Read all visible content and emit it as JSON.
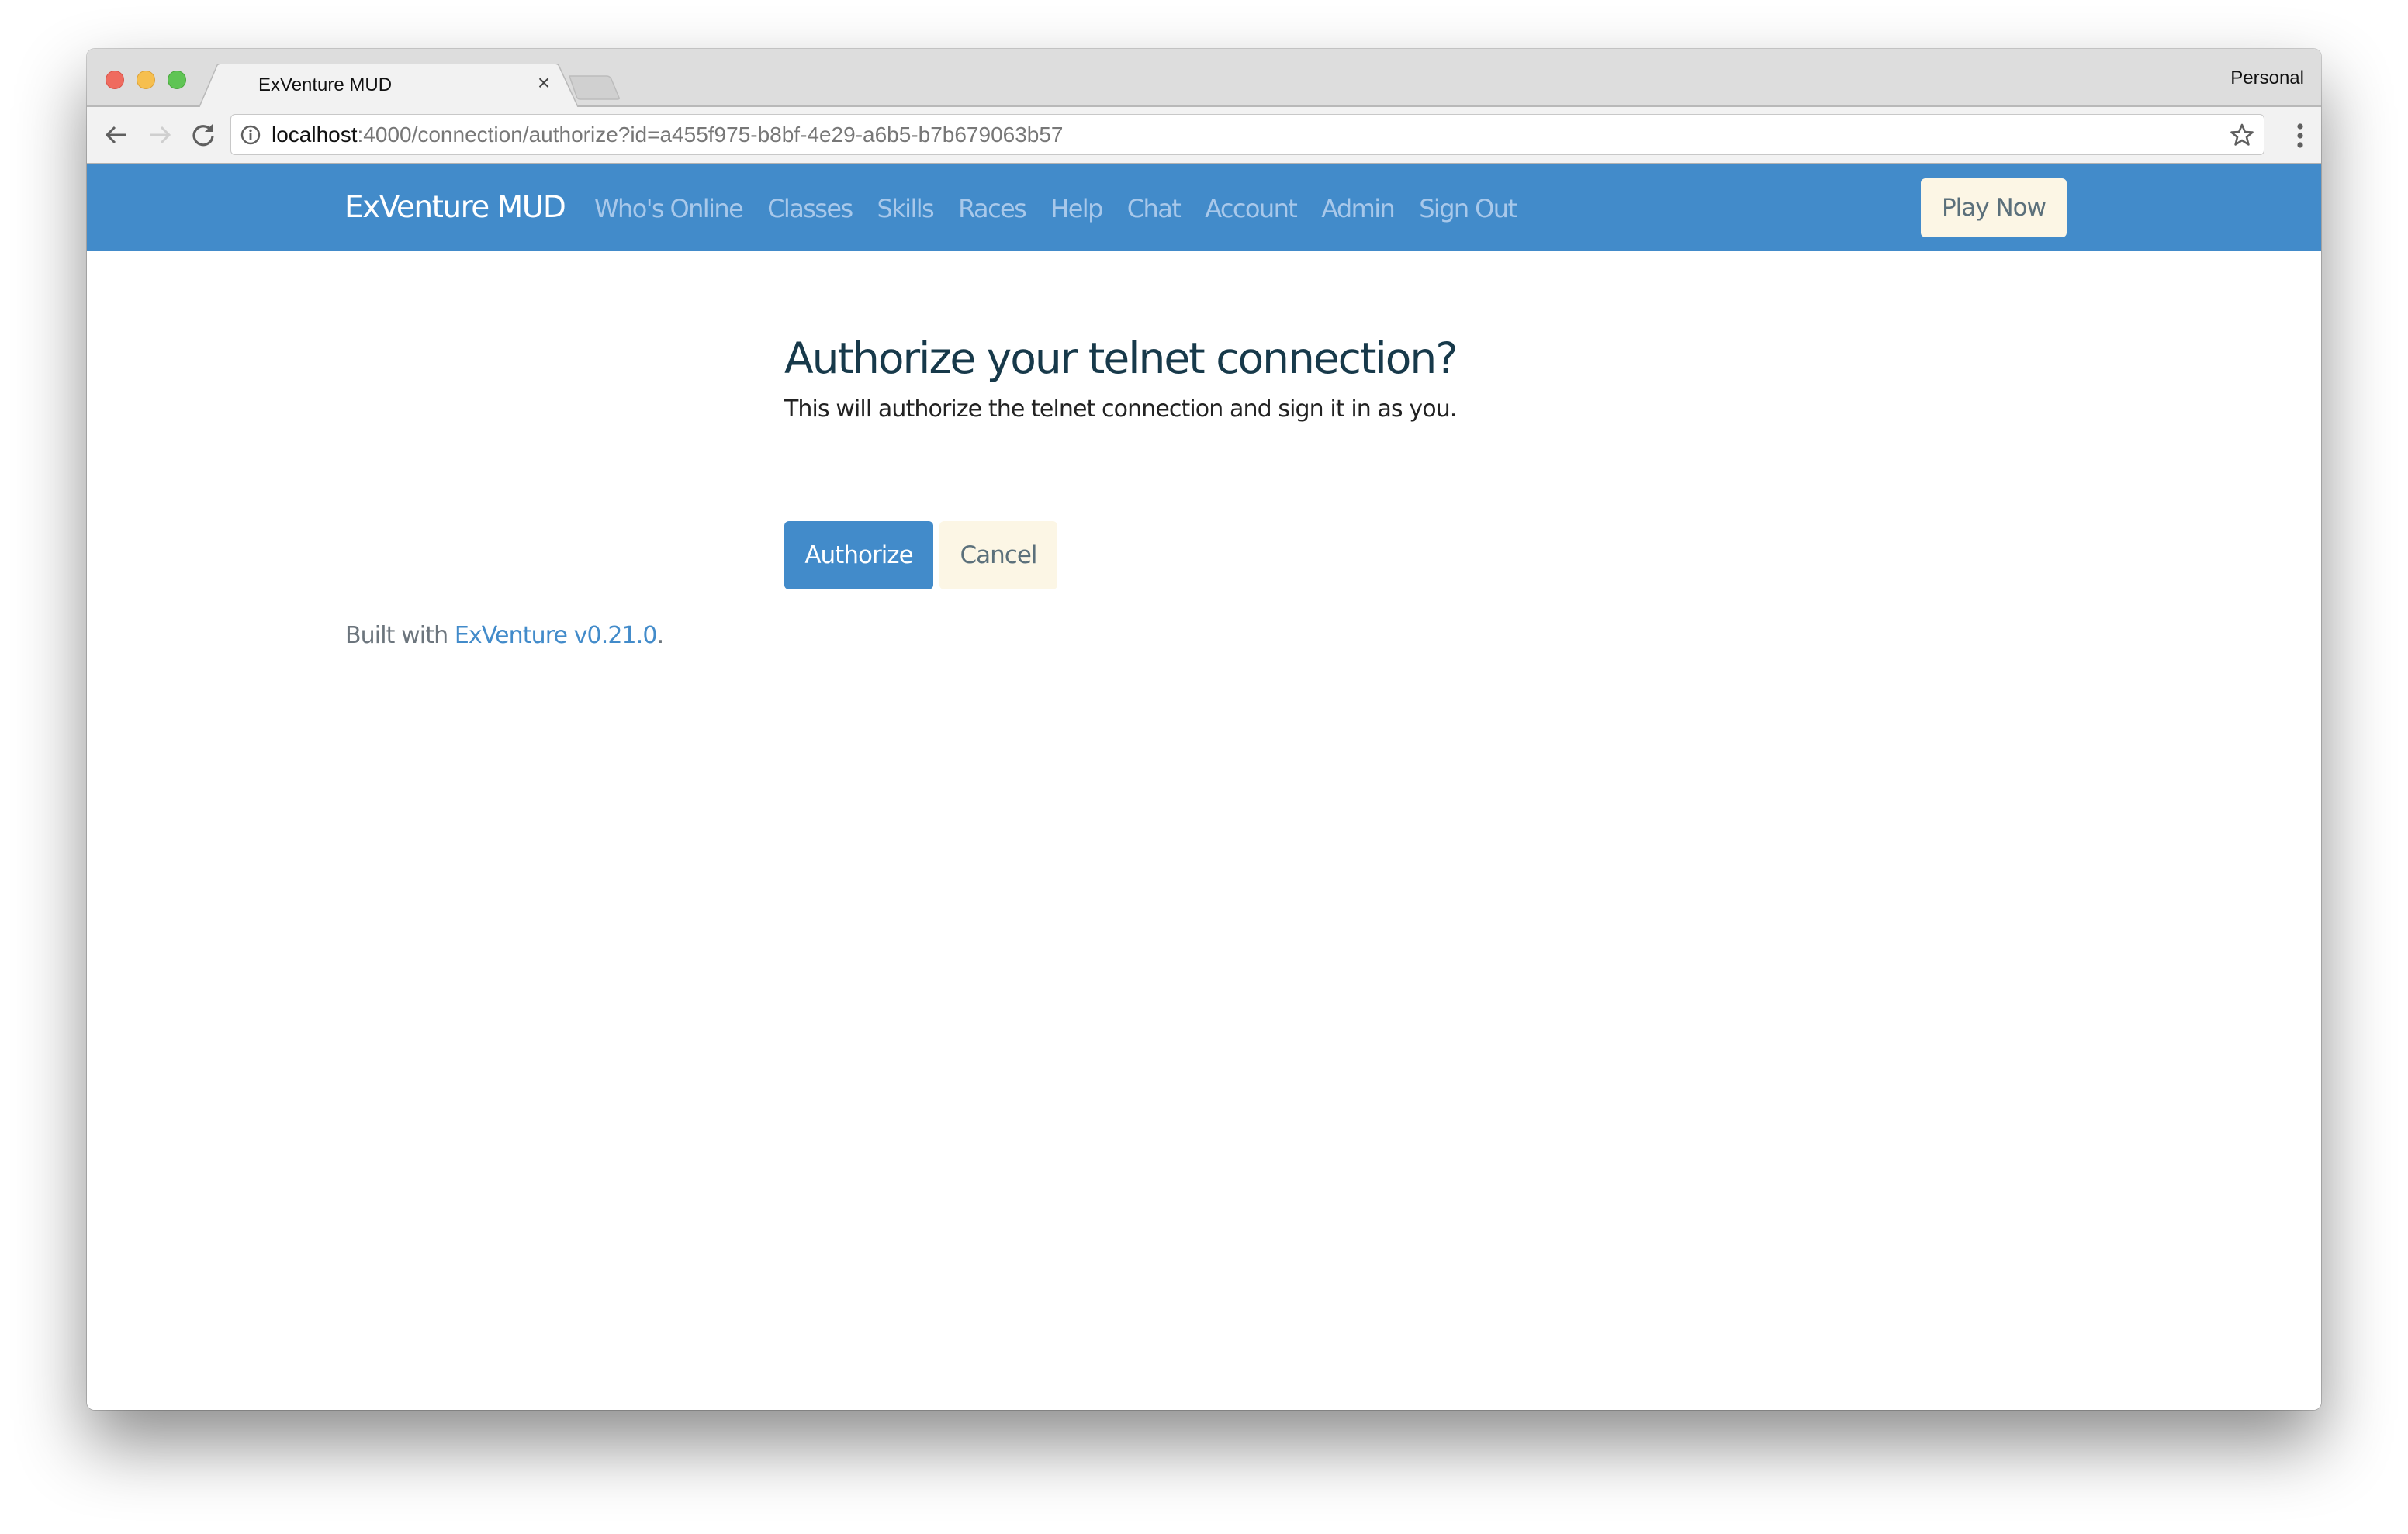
{
  "browser": {
    "tab_title": "ExVenture MUD",
    "tab_close": "×",
    "profile": "Personal",
    "url_host": "localhost",
    "url_rest": ":4000/connection/authorize?id=a455f975-b8bf-4e29-a6b5-b7b679063b57",
    "icons": {
      "back": "arrow-left-icon",
      "forward": "arrow-right-icon",
      "reload": "reload-icon",
      "info": "info-icon",
      "bookmark": "star-icon",
      "menu": "kebab-menu-icon"
    }
  },
  "navbar": {
    "brand": "ExVenture MUD",
    "links": [
      "Who's Online",
      "Classes",
      "Skills",
      "Races",
      "Help",
      "Chat",
      "Account",
      "Admin",
      "Sign Out"
    ],
    "play_button": "Play Now"
  },
  "main": {
    "heading": "Authorize your telnet connection?",
    "description": "This will authorize the telnet connection and sign it in as you.",
    "authorize_button": "Authorize",
    "cancel_button": "Cancel"
  },
  "footer": {
    "prefix": "Built with ",
    "link_text": "ExVenture v0.21.0",
    "suffix": "."
  },
  "colors": {
    "navbar_bg": "#428bca",
    "nav_link": "#a8c8ea",
    "heading": "#17394a",
    "secondary_button_bg": "#fcf6e5",
    "footer_text": "#6c757d"
  }
}
